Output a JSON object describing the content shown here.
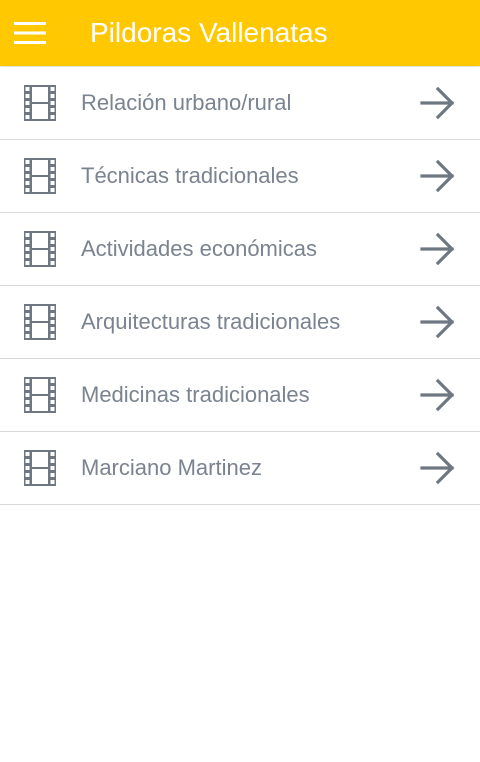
{
  "app": {
    "title": "Pildoras Vallenatas",
    "menu_icon": "hamburger-menu-icon",
    "bar_color": "#ffc800"
  },
  "list": {
    "row_icon": "film-strip-icon",
    "action_icon": "arrow-right-icon",
    "items": [
      {
        "label": "Relación urbano/rural"
      },
      {
        "label": "Técnicas tradicionales"
      },
      {
        "label": "Actividades económicas"
      },
      {
        "label": "Arquitecturas tradicionales"
      },
      {
        "label": "Medicinas tradicionales"
      },
      {
        "label": "Marciano Martinez"
      }
    ]
  }
}
